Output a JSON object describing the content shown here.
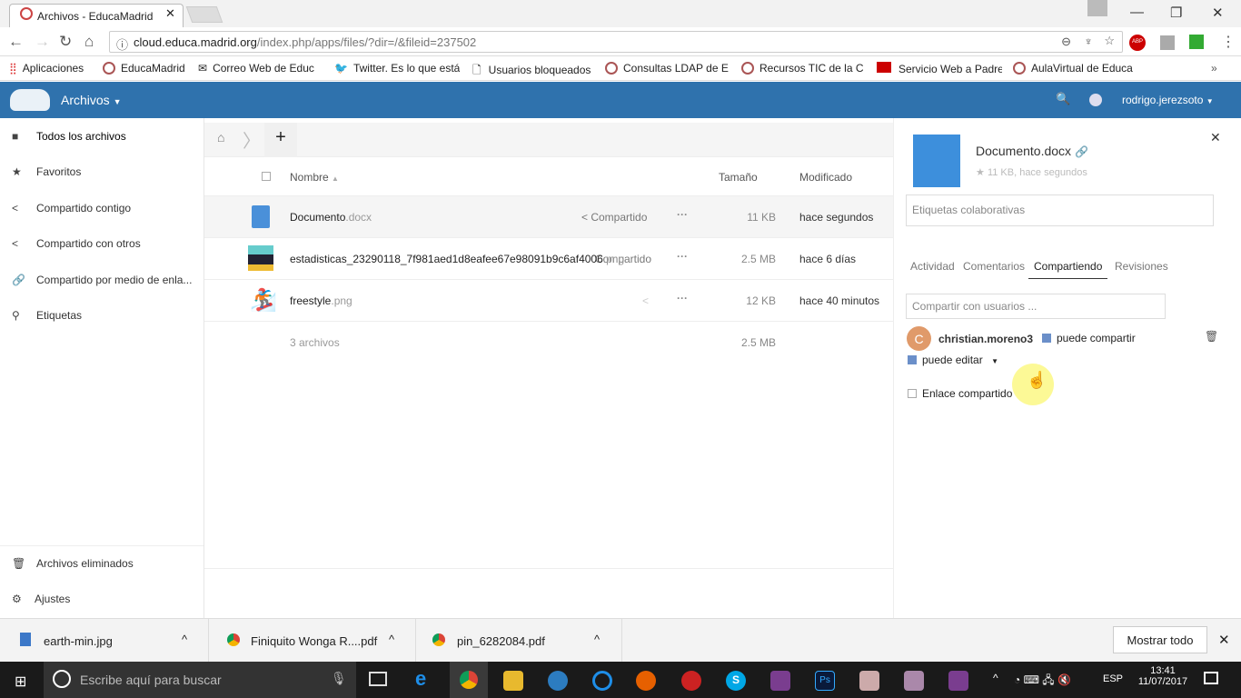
{
  "browser": {
    "tab_title": "Archivos - EducaMadrid",
    "url_host": "cloud.educa.madrid.org",
    "url_path": "/index.php/apps/files/?dir=/&fileid=237502",
    "bookmarks": [
      "Aplicaciones",
      "EducaMadrid",
      "Correo Web de Educ",
      "Twitter. Es lo que está",
      "Usuarios bloqueados",
      "Consultas LDAP de E",
      "Recursos TIC de la C",
      "Servicio Web a Padre",
      "AulaVirtual de Educa"
    ],
    "more": "»",
    "abp": "ABP"
  },
  "header": {
    "app": "Archivos",
    "user": "rodrigo.jerezsoto"
  },
  "sidebar": {
    "items": [
      "Todos los archivos",
      "Favoritos",
      "Compartido contigo",
      "Compartido con otros",
      "Compartido por medio de enla...",
      "Etiquetas"
    ],
    "deleted": "Archivos eliminados",
    "settings": "Ajustes"
  },
  "files": {
    "col_name": "Nombre",
    "col_size": "Tamaño",
    "col_modified": "Modificado",
    "rows": [
      {
        "name": "Documento",
        "ext": ".docx",
        "share": "Compartido",
        "size": "11 KB",
        "modified": "hace segundos"
      },
      {
        "name": "estadisticas_23290118_7f981aed1d8eafee67e98091b9c6af4006",
        "ext": ".png",
        "share": "Compartido",
        "size": "2.5 MB",
        "modified": "hace 6 días"
      },
      {
        "name": "freestyle",
        "ext": ".png",
        "share": "",
        "size": "12 KB",
        "modified": "hace 40 minutos"
      }
    ],
    "summary": "3 archivos",
    "total": "2.5 MB"
  },
  "panel": {
    "filename": "Documento.docx",
    "meta": "11 KB, hace segundos",
    "tags_placeholder": "Etiquetas colaborativas",
    "tabs": [
      "Actividad",
      "Comentarios",
      "Compartiendo",
      "Revisiones"
    ],
    "active_tab": "Compartiendo",
    "share_placeholder": "Compartir con usuarios ...",
    "share_user": "christian.moreno3",
    "avatar_letter": "C",
    "can_share": "puede compartir",
    "can_edit": "puede editar",
    "link_share": "Enlace compartido"
  },
  "downloads": {
    "items": [
      "earth-min.jpg",
      "Finiquito Wonga R....pdf",
      "pin_6282084.pdf"
    ],
    "show_all": "Mostrar todo"
  },
  "taskbar": {
    "search": "Escribe aquí para buscar",
    "lang": "ESP",
    "time": "13:41",
    "date": "11/07/2017"
  }
}
